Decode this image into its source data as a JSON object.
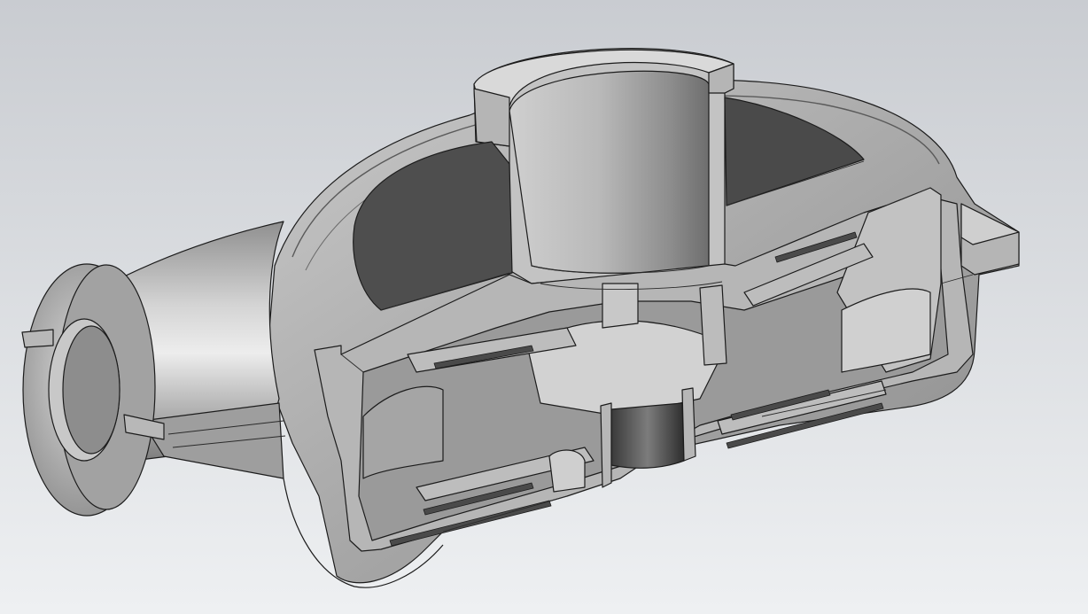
{
  "viewport": {
    "background_top": "#c9ccd1",
    "background_bottom": "#eef0f2",
    "model_light": "#e2e2e2",
    "model_mid": "#a9a9a9",
    "model_dark": "#4a4a4a",
    "model_shadow": "#3d3d3d",
    "edge_color": "#1c1c1c",
    "cut_face": "#b4b4b4"
  },
  "model": {
    "kind": "sectioned pump housing (3D CAD cut view)",
    "parts": [
      "inlet-flange",
      "inlet-pipe",
      "volute-casing",
      "discharge-nozzle",
      "impeller",
      "shaft-bore",
      "mounting-foot"
    ]
  }
}
